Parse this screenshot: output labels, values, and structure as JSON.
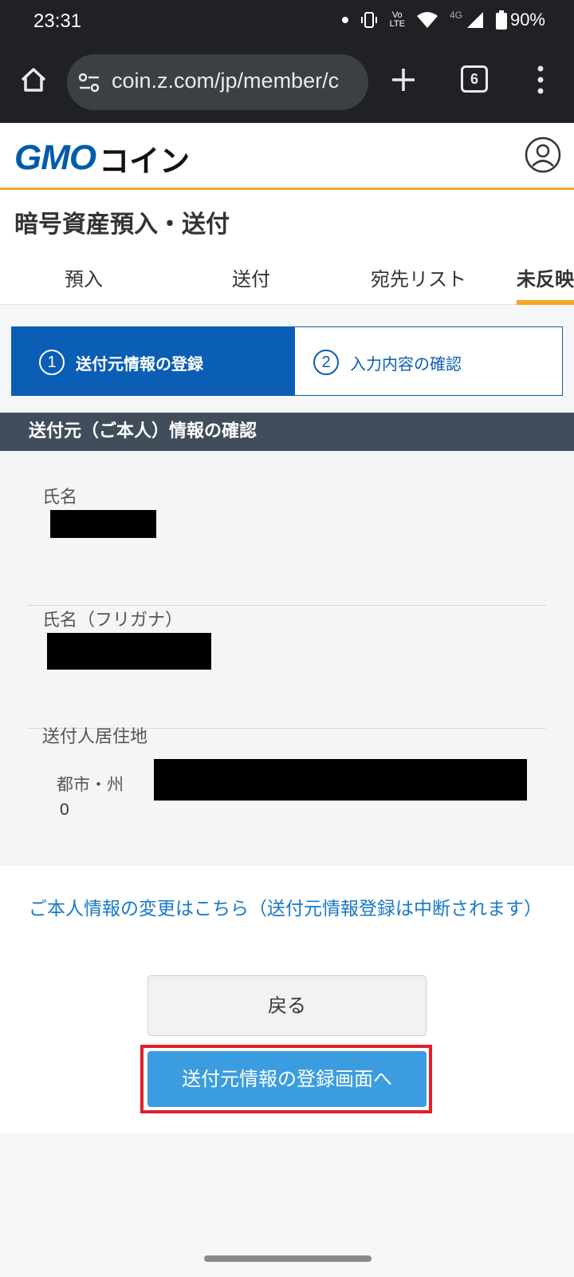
{
  "status": {
    "time": "23:31",
    "volte": "Vo\nLTE",
    "net": "4G",
    "battery": "90%"
  },
  "browser": {
    "url": "coin.z.com/jp/member/c",
    "tab_count": "6"
  },
  "brand": {
    "logo_main": "GMO",
    "logo_sub": "コイン"
  },
  "page": {
    "title": "暗号資産預入・送付"
  },
  "tabs": [
    {
      "label": "預入"
    },
    {
      "label": "送付"
    },
    {
      "label": "宛先リスト"
    },
    {
      "label": "未反映"
    }
  ],
  "steps": [
    {
      "num": "1",
      "label": "送付元情報の登録"
    },
    {
      "num": "2",
      "label": "入力内容の確認"
    }
  ],
  "section": {
    "title": "送付元（ご本人）情報の確認"
  },
  "fields": {
    "name_label": "氏名",
    "kana_label": "氏名（フリガナ）",
    "address_label": "送付人居住地",
    "city_label": "都市・州",
    "city_extra": "0"
  },
  "links": {
    "change_info": "ご本人情報の変更はこちら（送付元情報登録は中断されます）"
  },
  "buttons": {
    "back": "戻る",
    "register": "送付元情報の登録画面へ"
  },
  "colors": {
    "brand_blue": "#0a5eb5",
    "accent_orange": "#f5a623",
    "button_blue": "#3b9de0",
    "highlight_red": "#e0202a"
  }
}
